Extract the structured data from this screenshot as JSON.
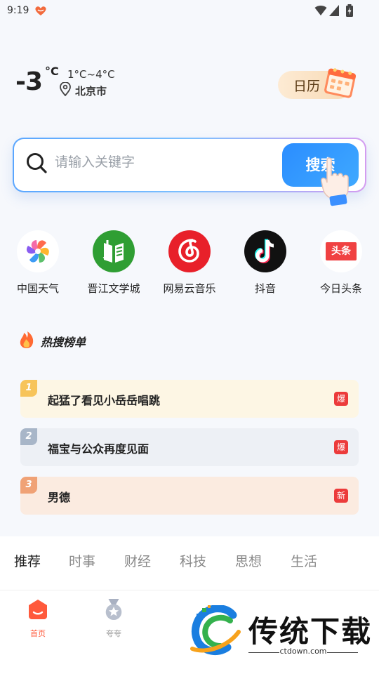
{
  "status_bar": {
    "time": "9:19"
  },
  "weather": {
    "temperature": "-3",
    "unit": "°C",
    "range": "1°C~4°C",
    "location": "北京市"
  },
  "calendar": {
    "label": "日历"
  },
  "search": {
    "placeholder": "请输入关键字",
    "button_label": "搜索"
  },
  "apps": [
    {
      "label": "中国天气",
      "icon": "pinwheel-icon"
    },
    {
      "label": "晋江文学城",
      "icon": "book-icon"
    },
    {
      "label": "网易云音乐",
      "icon": "netease-music-icon"
    },
    {
      "label": "抖音",
      "icon": "tiktok-icon"
    },
    {
      "label": "今日头条",
      "icon": "toutiao-icon",
      "icon_text": "头条"
    }
  ],
  "hot_search": {
    "title": "热搜榜单",
    "items": [
      {
        "rank": "1",
        "text": "起猛了看见小岳岳唱跳",
        "tag": "爆",
        "bg": "#fdf6e4",
        "rank_color": "#f7c45a"
      },
      {
        "rank": "2",
        "text": "福宝与公众再度见面",
        "tag": "爆",
        "bg": "#edf0f5",
        "rank_color": "#a8b6c8"
      },
      {
        "rank": "3",
        "text": "男德",
        "tag": "新",
        "bg": "#fbebe0",
        "rank_color": "#f0a276"
      }
    ]
  },
  "tabs": [
    {
      "label": "推荐",
      "active": true
    },
    {
      "label": "时事",
      "active": false
    },
    {
      "label": "财经",
      "active": false
    },
    {
      "label": "科技",
      "active": false
    },
    {
      "label": "思想",
      "active": false
    },
    {
      "label": "生活",
      "active": false
    }
  ],
  "bottom_nav": [
    {
      "label": "首页",
      "active": true,
      "icon": "home-icon"
    },
    {
      "label": "夸夸",
      "active": false,
      "icon": "medal-icon"
    }
  ],
  "watermark": {
    "title": "传统下载",
    "url": "ctdown.com"
  },
  "colors": {
    "accent": "#ff5a3c",
    "search_button": "#2b8dff",
    "tag_red": "#ec3b3b"
  }
}
